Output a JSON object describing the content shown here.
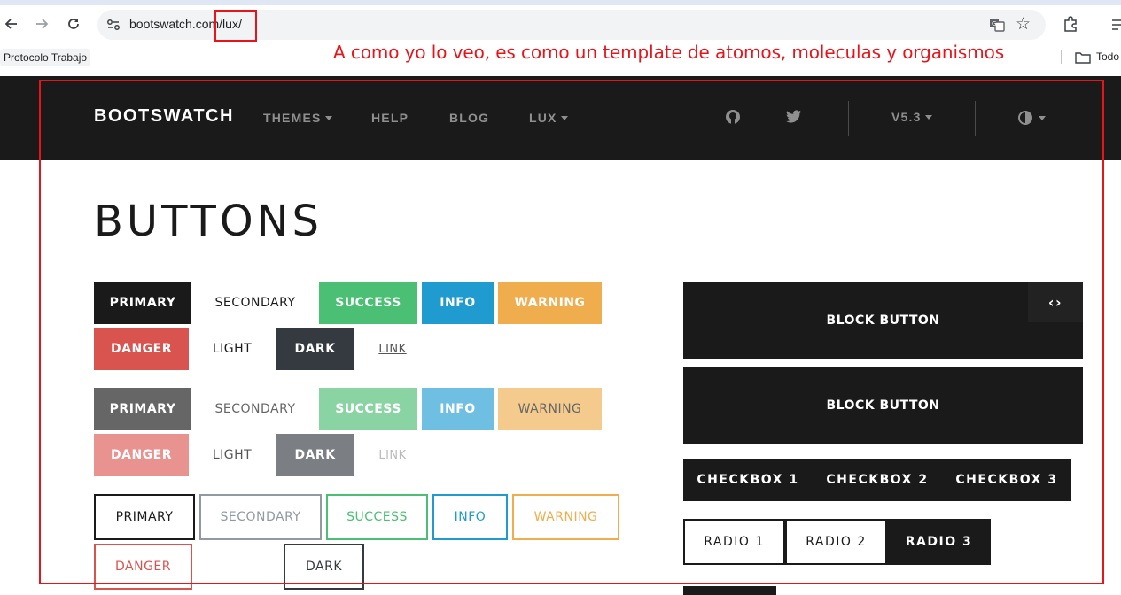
{
  "browser": {
    "url_text": "bootswatch.com/lux/",
    "bookmark_label": "Protocolo Trabajo",
    "bookmarks_all_label": "Todo"
  },
  "annotation": "A como yo lo veo, es como un template de atomos, moleculas y organismos",
  "site_nav": {
    "brand": "BOOTSWATCH",
    "links": [
      "THEMES",
      "HELP",
      "BLOG",
      "LUX"
    ],
    "version": "V5.3"
  },
  "page_title": "BUTTONS",
  "solid_row1": [
    "PRIMARY",
    "SECONDARY",
    "SUCCESS",
    "INFO",
    "WARNING"
  ],
  "solid_row2": [
    "DANGER",
    "LIGHT",
    "DARK",
    "LINK"
  ],
  "disabled_row1": [
    "PRIMARY",
    "SECONDARY",
    "SUCCESS",
    "INFO",
    "WARNING"
  ],
  "disabled_row2": [
    "DANGER",
    "LIGHT",
    "DARK",
    "LINK"
  ],
  "outline_row1": [
    "PRIMARY",
    "SECONDARY",
    "SUCCESS",
    "INFO",
    "WARNING"
  ],
  "outline_row2": [
    "DANGER",
    "DARK"
  ],
  "block_buttons": [
    "BLOCK BUTTON",
    "BLOCK BUTTON"
  ],
  "code_toggle": "‹›",
  "checkboxes": [
    "CHECKBOX 1",
    "CHECKBOX 2",
    "CHECKBOX 3"
  ],
  "radios": [
    "RADIO 1",
    "RADIO 2",
    "RADIO 3"
  ],
  "colors": {
    "primary": "#1a1a1a",
    "success": "#4bbf73",
    "info": "#1f9bcf",
    "warning": "#f0ad4e",
    "danger": "#d9534f",
    "dark": "#343a40",
    "annotation_red": "#e8141a"
  }
}
